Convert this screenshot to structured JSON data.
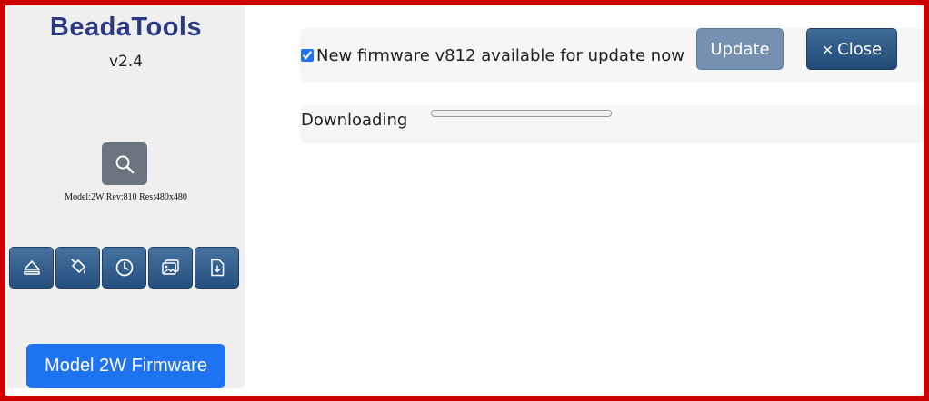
{
  "sidebar": {
    "app_title": "BeadaTools",
    "version": "v2.4",
    "search_icon": "search-icon",
    "device_info": "Model:2W Rev:810 Res:480x480",
    "tools": [
      {
        "icon": "eject-icon"
      },
      {
        "icon": "paint-bucket-icon"
      },
      {
        "icon": "clock-icon"
      },
      {
        "icon": "images-icon"
      },
      {
        "icon": "file-download-icon"
      }
    ],
    "firmware_button": "Model 2W Firmware"
  },
  "update": {
    "checked": true,
    "message": "New firmware v812 available for update now",
    "update_label": "Update",
    "close_glyph": "×",
    "close_label": "Close"
  },
  "download": {
    "label": "Downloading",
    "progress": 0
  },
  "colors": {
    "border": "#cc0000",
    "title": "#2b3a86",
    "tool_button": "#2f5a88",
    "primary": "#1e73f0",
    "update_button": "#7690b1"
  }
}
